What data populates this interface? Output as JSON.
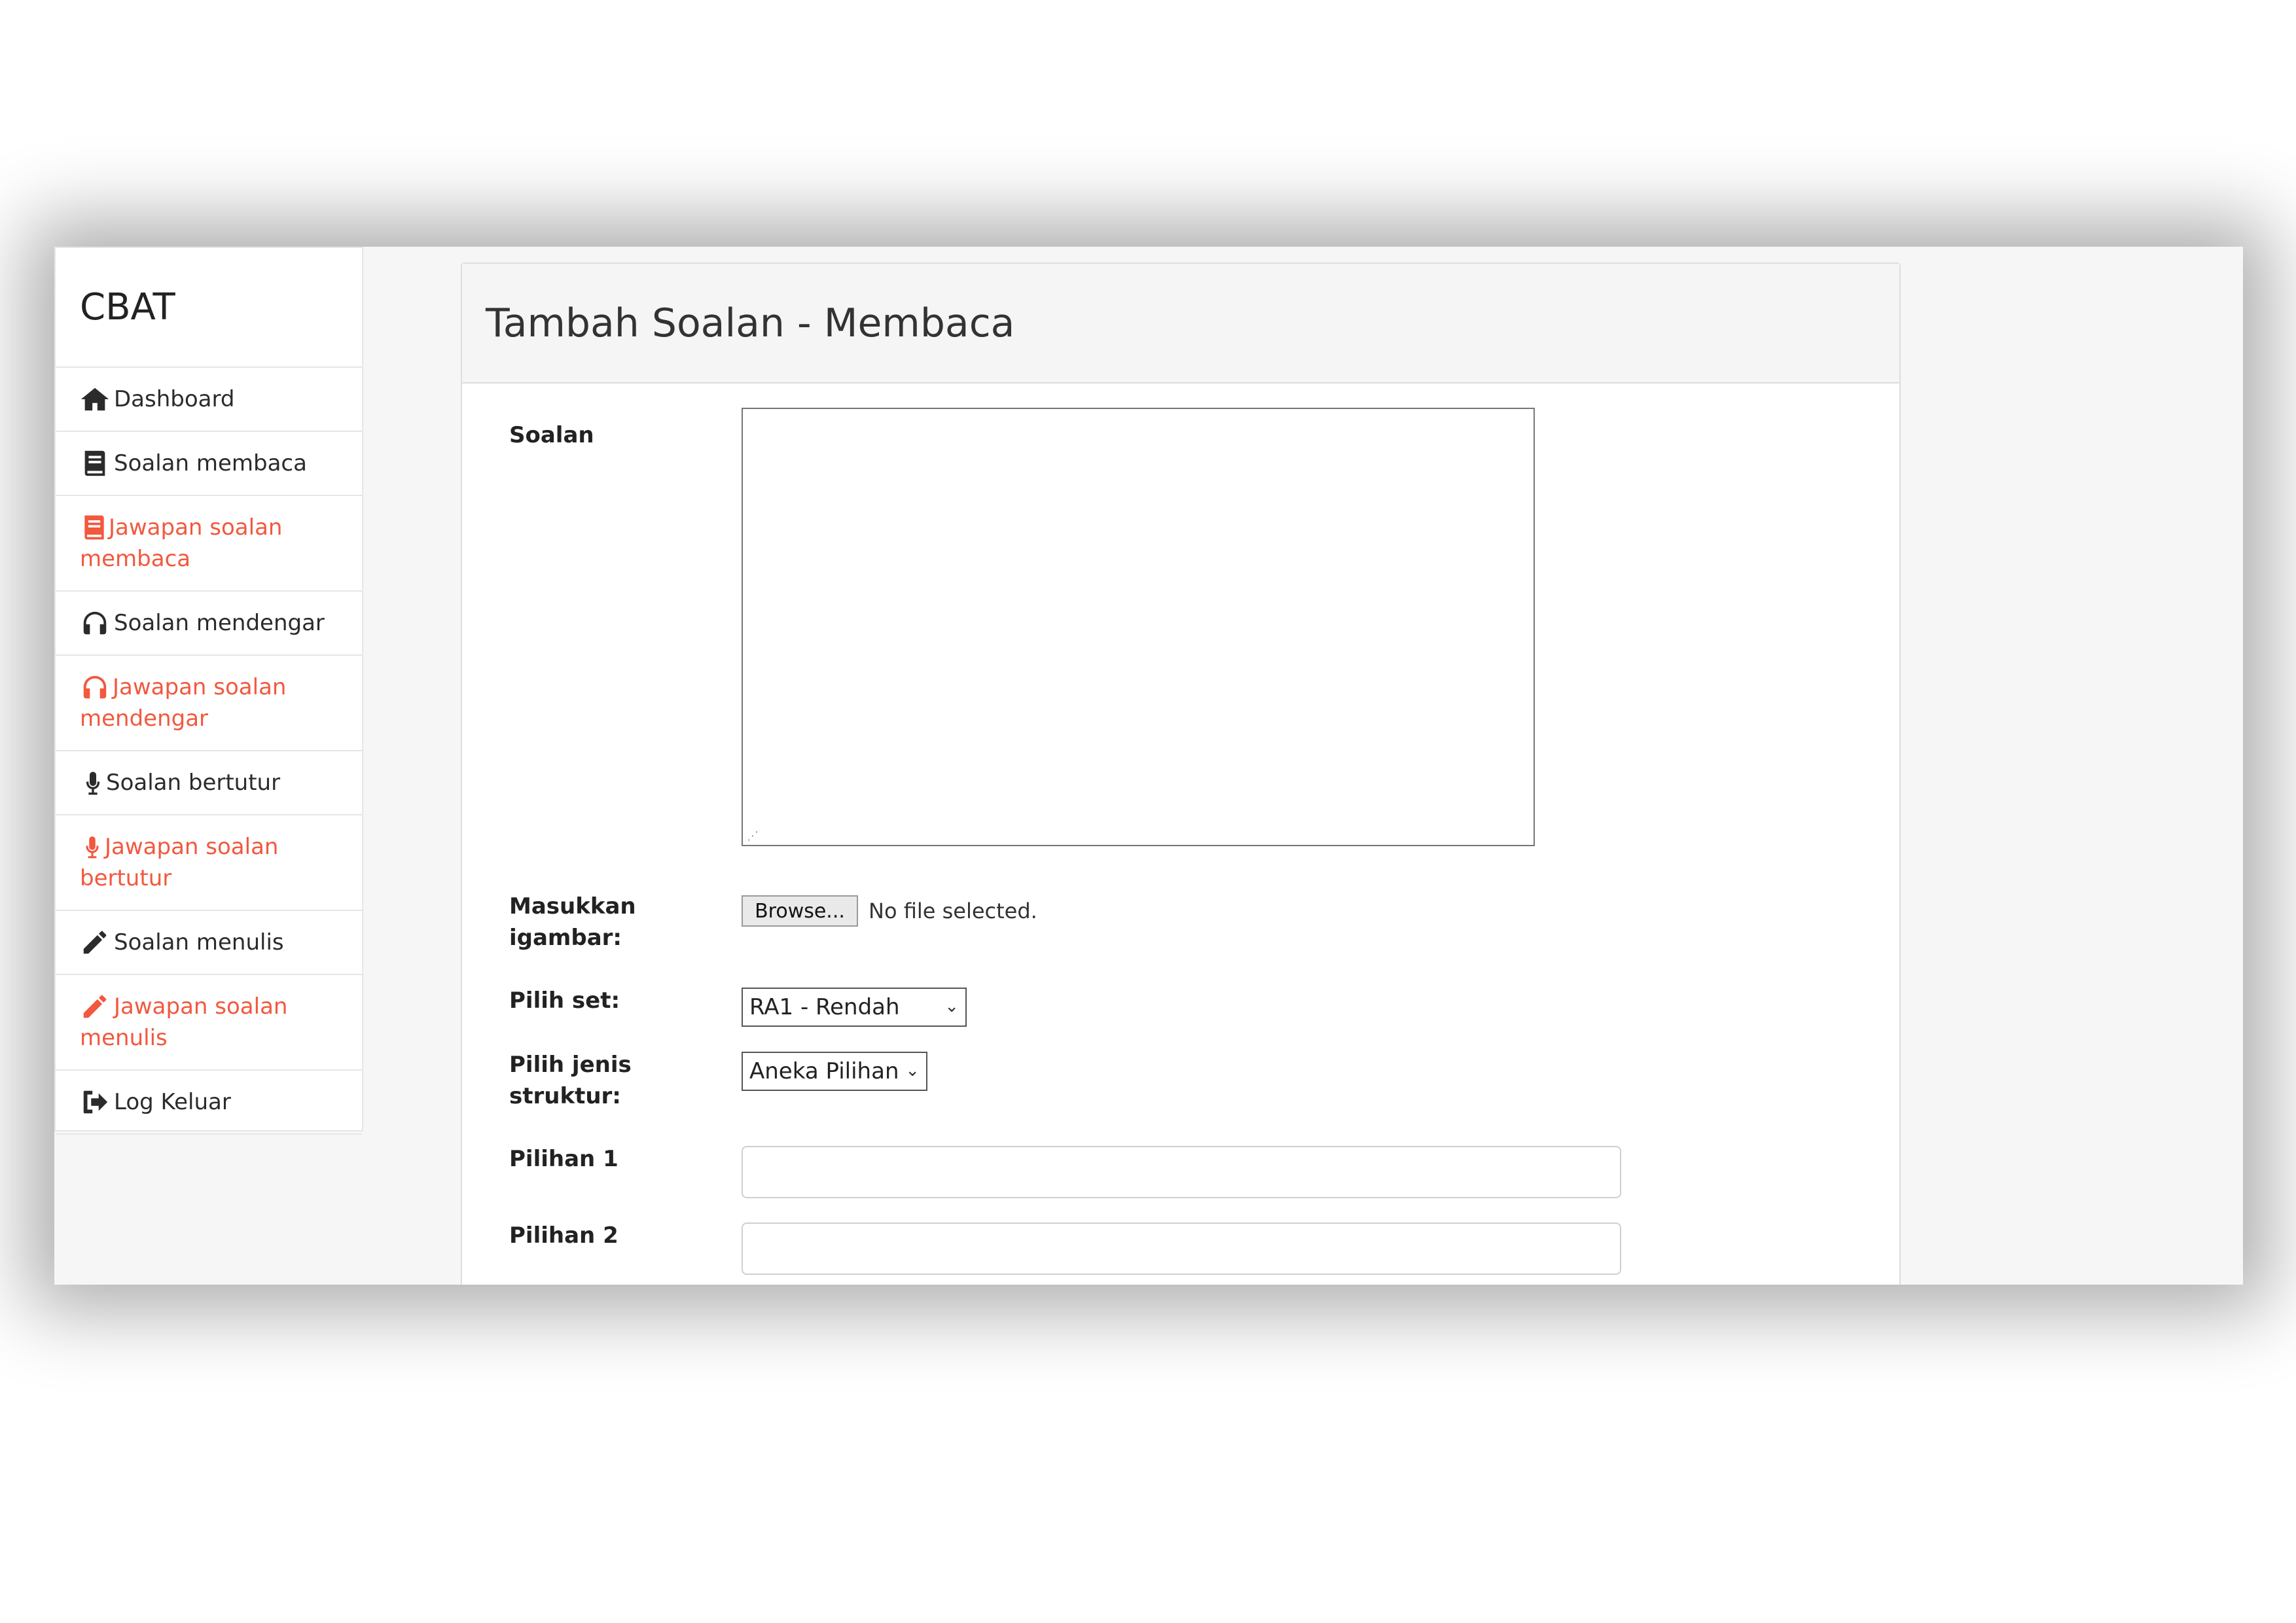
{
  "brand": "CBAT",
  "accent_color": "#f2583e",
  "sidebar": {
    "items": [
      {
        "label": "Dashboard",
        "icon": "home-icon"
      },
      {
        "label": "Soalan membaca",
        "icon": "book-icon"
      },
      {
        "label": "Jawapan soalan membaca",
        "icon": "book-icon"
      },
      {
        "label": "Soalan mendengar",
        "icon": "headphones-icon"
      },
      {
        "label": "Jawapan soalan mendengar",
        "icon": "headphones-icon"
      },
      {
        "label": "Soalan bertutur",
        "icon": "microphone-icon"
      },
      {
        "label": "Jawapan soalan bertutur",
        "icon": "microphone-icon"
      },
      {
        "label": "Soalan menulis",
        "icon": "pencil-icon"
      },
      {
        "label": "Jawapan soalan menulis",
        "icon": "pencil-icon"
      },
      {
        "label": "Log Keluar",
        "icon": "sign-out-icon"
      }
    ]
  },
  "panel": {
    "title": "Tambah Soalan - Membaca"
  },
  "form": {
    "soalan_label": "Soalan",
    "soalan_value": "",
    "gambar_label": "Masukkan igambar:",
    "browse_label": "Browse...",
    "no_file_text": "No file selected.",
    "set_label": "Pilih set:",
    "set_value": "RA1 - Rendah",
    "struktur_label": "Pilih jenis struktur:",
    "struktur_value": "Aneka Pilihan",
    "pilihan1_label": "Pilihan 1",
    "pilihan1_value": "",
    "pilihan2_label": "Pilihan 2",
    "pilihan2_value": ""
  }
}
